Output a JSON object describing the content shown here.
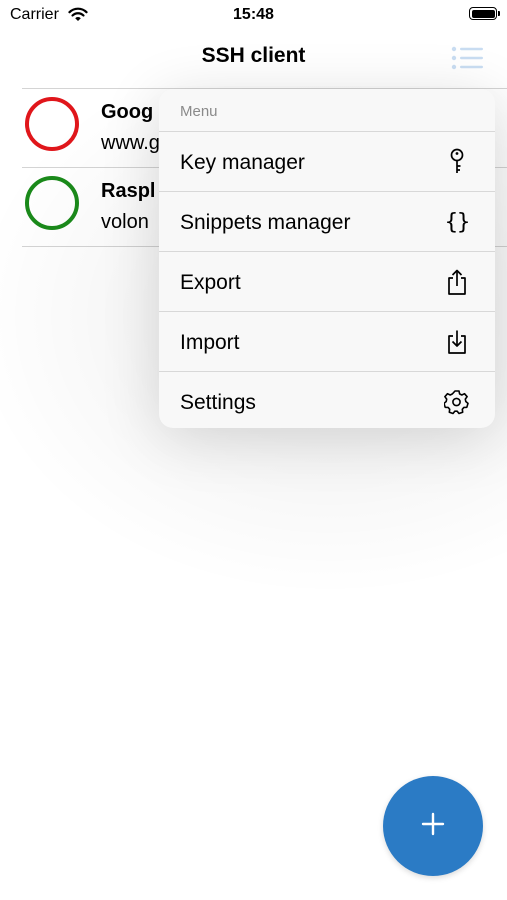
{
  "status_bar": {
    "carrier": "Carrier",
    "time": "15:48"
  },
  "navbar": {
    "title": "SSH client"
  },
  "hosts": [
    {
      "name": "Goog",
      "host": "www.g",
      "status_color": "#e0161b"
    },
    {
      "name": "Raspl",
      "host": "volon",
      "status_color": "#1a8a1a"
    }
  ],
  "menu": {
    "header": "Menu",
    "items": [
      {
        "label": "Key manager",
        "icon": "key-icon"
      },
      {
        "label": "Snippets manager",
        "icon": "braces-icon",
        "glyph": "{}"
      },
      {
        "label": "Export",
        "icon": "share-icon"
      },
      {
        "label": "Import",
        "icon": "import-icon"
      },
      {
        "label": "Settings",
        "icon": "gear-icon"
      }
    ]
  },
  "colors": {
    "accent": "#2b7bc5",
    "nav_icon": "#c9ddf2"
  }
}
